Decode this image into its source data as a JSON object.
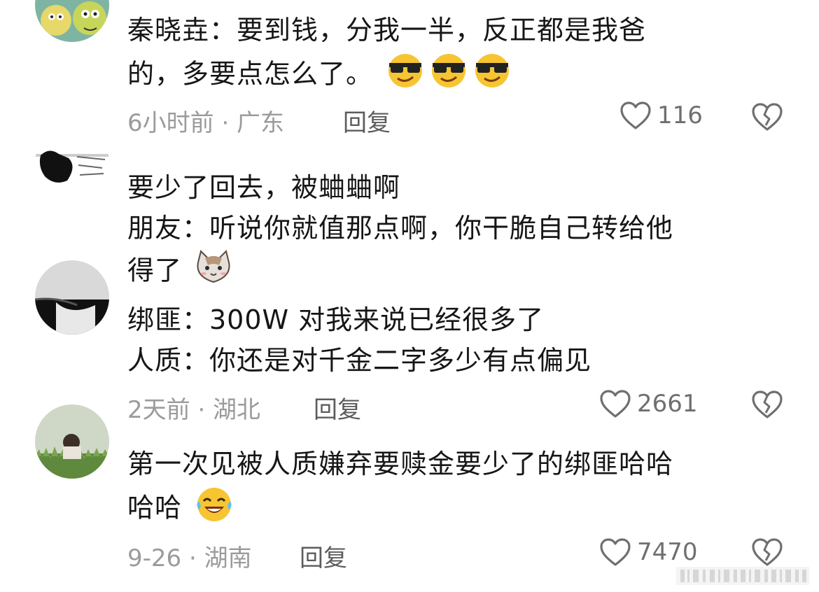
{
  "comments": [
    {
      "lines": [
        "秦晓垚：要到钱，分我一半，反正都是我爸",
        "的，多要点怎么了。"
      ],
      "emojis": [
        "sunglasses-emoji",
        "sunglasses-emoji",
        "sunglasses-emoji"
      ],
      "meta": "6小时前 · 广东",
      "reply": "回复",
      "likes": "116"
    },
    {
      "lines": [
        "要少了回去，被蛐蛐啊",
        "朋友：听说你就值那点啊，你干脆自己转给他",
        "得了"
      ],
      "emojis": [
        "cat-emoji"
      ],
      "meta": "",
      "reply": "",
      "likes": ""
    },
    {
      "lines": [
        "绑匪：300W 对我来说已经很多了",
        "人质：你还是对千金二字多少有点偏见"
      ],
      "emojis": [],
      "meta": "2天前 · 湖北",
      "reply": "回复",
      "likes": "2661"
    },
    {
      "lines": [
        "第一次见被人质嫌弃要赎金要少了的绑匪哈哈",
        "哈哈"
      ],
      "emojis": [
        "laughing-tears-emoji"
      ],
      "meta": "9-26 · 湖南",
      "reply": "回复",
      "likes": "7470"
    }
  ],
  "colors": {
    "text": "#161616",
    "meta": "#9b9b9b",
    "reply": "#5c5c5c",
    "icon": "#6f6f6f"
  }
}
